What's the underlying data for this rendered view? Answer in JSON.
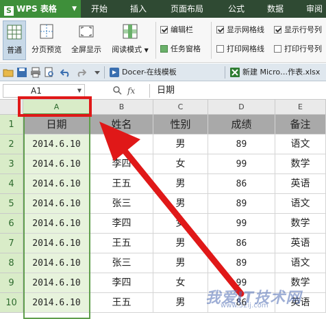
{
  "app": {
    "title": "WPS 表格",
    "logo_letter": "S"
  },
  "menu": [
    "开始",
    "插入",
    "页面布局",
    "公式",
    "数据",
    "审阅"
  ],
  "ribbon": {
    "buttons": [
      "普通",
      "分页预览",
      "全屏显示",
      "阅读模式"
    ],
    "checks": [
      {
        "label": "编辑栏",
        "checked": true
      },
      {
        "label": "任务窗格",
        "checked": false
      },
      {
        "label": "显示网格线",
        "checked": true
      },
      {
        "label": "打印网格线",
        "checked": false
      },
      {
        "label": "显示行号列",
        "checked": true
      },
      {
        "label": "打印行号列",
        "checked": false
      }
    ]
  },
  "tabs": [
    "Docer-在线模板",
    "新建 Micro…作表.xlsx"
  ],
  "formula_bar": {
    "cell_ref": "A1",
    "fx": "fx",
    "content": "日期"
  },
  "columns": [
    "A",
    "B",
    "C",
    "D",
    "E"
  ],
  "rows": [
    "1",
    "2",
    "3",
    "4",
    "5",
    "6",
    "7",
    "8",
    "9",
    "10"
  ],
  "table": {
    "headers": [
      "日期",
      "姓名",
      "性别",
      "成绩",
      "备注"
    ],
    "data": [
      [
        "2014.6.10",
        "张三",
        "男",
        "89",
        "语文"
      ],
      [
        "2014.6.10",
        "李四",
        "女",
        "99",
        "数学"
      ],
      [
        "2014.6.10",
        "王五",
        "男",
        "86",
        "英语"
      ],
      [
        "2014.6.10",
        "张三",
        "男",
        "89",
        "语文"
      ],
      [
        "2014.6.10",
        "李四",
        "女",
        "99",
        "数学"
      ],
      [
        "2014.6.10",
        "王五",
        "男",
        "86",
        "英语"
      ],
      [
        "2014.6.10",
        "张三",
        "男",
        "89",
        "语文"
      ],
      [
        "2014.6.10",
        "李四",
        "女",
        "99",
        "数学"
      ],
      [
        "2014.6.10",
        "王五",
        "男",
        "86",
        "英语"
      ]
    ]
  },
  "watermark": {
    "text": "我爱IT技术网",
    "sub": "www.52ij.com"
  },
  "colors": {
    "menubar": "#2f4a33",
    "app_button": "#3e8f3a",
    "callout": "#e01818",
    "selection": "#d9ecc8"
  }
}
